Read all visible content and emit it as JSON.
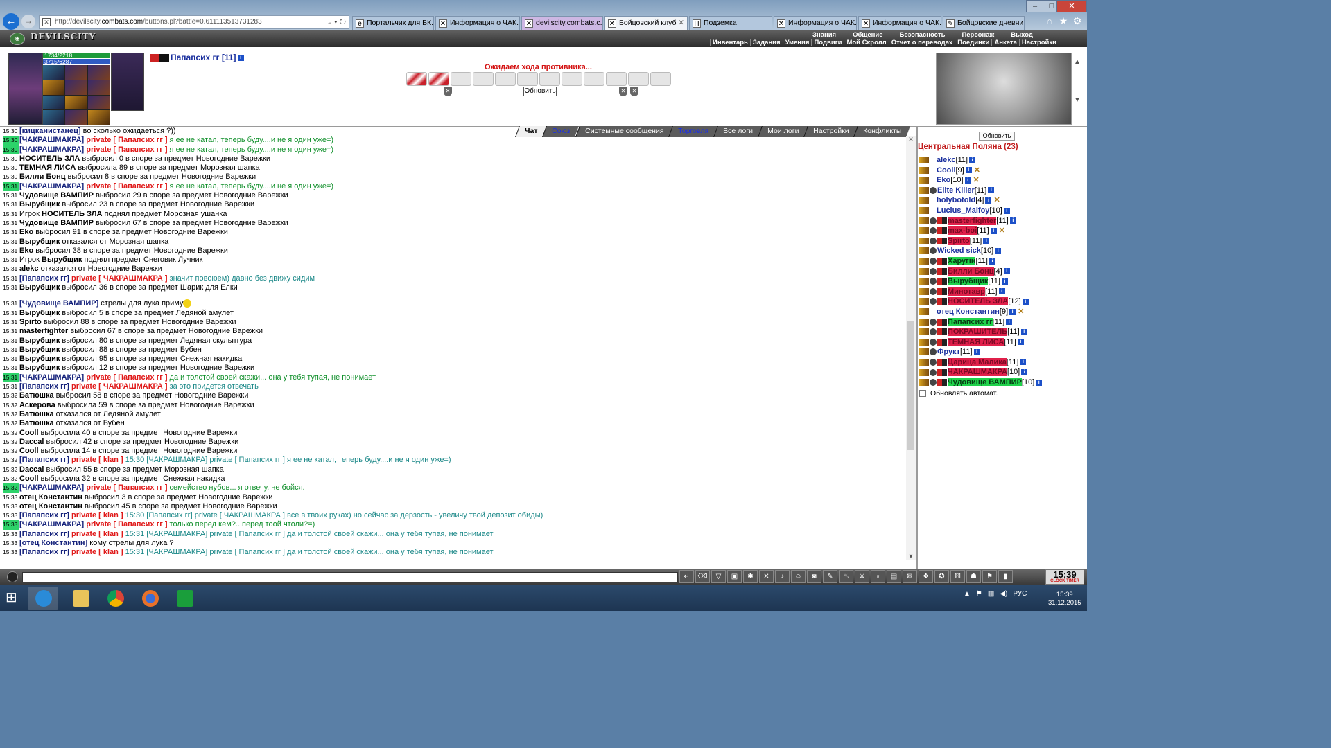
{
  "browser": {
    "address": "http://devilscity.combats.com/buttons.pl?battle=0.611113513731283",
    "address_prefix": "http://devilscity.",
    "address_domain": "combats.com",
    "address_suffix": "/buttons.pl?battle=0.611113513731283",
    "tabs": [
      {
        "label": "Портальчик для БК..."
      },
      {
        "label": "Информация о ЧАК..."
      },
      {
        "label": "devilscity.combats.c..."
      },
      {
        "label": "Бойцовский клуб"
      },
      {
        "label": "Подземка"
      },
      {
        "label": "Информация о ЧАК..."
      },
      {
        "label": "Информация о ЧАК..."
      },
      {
        "label": "Бойцовские дневни..."
      }
    ]
  },
  "game": {
    "logo": "DEVILSCITY",
    "menu_top": [
      "Знания",
      "Общение",
      "Безопасность",
      "Персонаж",
      "Выход"
    ],
    "menu_bottom": [
      "Инвентарь",
      "Задания",
      "Умения",
      "Подвиги",
      "Мой Скролл",
      "Отчет о переводах",
      "Поединки",
      "Анкета",
      "Настройки"
    ]
  },
  "battle": {
    "hp": "1734/2218",
    "mp": "3715/6287",
    "char_name": "Папапсих гг",
    "char_level": "[11]",
    "wait_msg": "Ожидаем хода противника...",
    "refresh": "Обновить"
  },
  "chat_tabs": [
    "Чат",
    "Союз",
    "Системные сообщения",
    "Торговля",
    "Все логи",
    "Мои логи",
    "Настройки",
    "Конфликты"
  ],
  "messages": [
    {
      "time": "15:30",
      "hl": false,
      "parts": [
        [
          "nb",
          "[кицканистанец]"
        ],
        [
          "",
          "",
          " во сколько ожидаеться ?))"
        ]
      ]
    },
    {
      "time": "15:30",
      "hl": false,
      "parts": [
        [
          "nb",
          "[кицканистанец]"
        ],
        [
          "",
          " во сколько ожидаеться ?))"
        ]
      ]
    },
    {
      "time": "15:30",
      "hl": true,
      "parts": [
        [
          "nb",
          "[ЧАКРАШМАКРА]"
        ],
        [
          "pv",
          " private [ Папапсих гг ]"
        ],
        [
          "gt",
          " я ее не катал, теперь буду....и не я один уже=)"
        ]
      ]
    },
    {
      "time": "15:30",
      "hl": true,
      "parts": [
        [
          "nb",
          "[ЧАКРАШМАКРА]"
        ],
        [
          "pv",
          " private [ Папапсих гг ]"
        ],
        [
          "gt",
          " я ее не катал, теперь буду....и не я один уже=)"
        ]
      ]
    },
    {
      "time": "15:30",
      "hl": false,
      "parts": [
        [
          "nk",
          "НОСИТЕЛЬ ЗЛА"
        ],
        [
          "",
          " выбросил 0 в споре за предмет Новогодние Варежки"
        ]
      ]
    },
    {
      "time": "15:30",
      "hl": false,
      "parts": [
        [
          "nk",
          "ТЕМНАЯ ЛИСА"
        ],
        [
          "",
          " выбросила 89 в споре за предмет Морозная шапка"
        ]
      ]
    },
    {
      "time": "15:30",
      "hl": false,
      "parts": [
        [
          "nk",
          "Билли Бонц"
        ],
        [
          "",
          " выбросил 8 в споре за предмет Новогодние Варежки"
        ]
      ]
    },
    {
      "time": "15:31",
      "hl": true,
      "parts": [
        [
          "nb",
          "[ЧАКРАШМАКРА]"
        ],
        [
          "pv",
          " private [ Папапсих гг ]"
        ],
        [
          "gt",
          " я ее не катал, теперь буду....и не я один уже=)"
        ]
      ]
    },
    {
      "time": "15:31",
      "hl": false,
      "parts": [
        [
          "nk",
          "Чудовище ВАМПИР"
        ],
        [
          "",
          " выбросил 29 в споре за предмет Новогодние Варежки"
        ]
      ]
    },
    {
      "time": "15:31",
      "hl": false,
      "parts": [
        [
          "nk",
          "Вырубщик"
        ],
        [
          "",
          " выбросил 23 в споре за предмет Новогодние Варежки"
        ]
      ]
    },
    {
      "time": "15:31",
      "hl": false,
      "parts": [
        [
          "",
          "Игрок "
        ],
        [
          "nk",
          "НОСИТЕЛЬ ЗЛА"
        ],
        [
          "",
          " поднял предмет Морозная ушанка"
        ]
      ]
    },
    {
      "time": "15:31",
      "hl": false,
      "parts": [
        [
          "nk",
          "Чудовище ВАМПИР"
        ],
        [
          "",
          " выбросил 67 в споре за предмет Новогодние Варежки"
        ]
      ]
    },
    {
      "time": "15:31",
      "hl": false,
      "parts": [
        [
          "nk",
          "Eko"
        ],
        [
          "",
          " выбросил 91 в споре за предмет Новогодние Варежки"
        ]
      ]
    },
    {
      "time": "15:31",
      "hl": false,
      "parts": [
        [
          "nk",
          "Вырубщик"
        ],
        [
          "",
          " отказался от Морозная шапка"
        ]
      ]
    },
    {
      "time": "15:31",
      "hl": false,
      "parts": [
        [
          "nk",
          "Eko"
        ],
        [
          "",
          " выбросил 38 в споре за предмет Новогодние Варежки"
        ]
      ]
    },
    {
      "time": "15:31",
      "hl": false,
      "parts": [
        [
          "",
          "Игрок "
        ],
        [
          "nk",
          "Вырубщик"
        ],
        [
          "",
          " поднял предмет Снеговик Лучник"
        ]
      ]
    },
    {
      "time": "15:31",
      "hl": false,
      "parts": [
        [
          "nk",
          "alekc"
        ],
        [
          "",
          " отказался от Новогодние Варежки"
        ]
      ]
    },
    {
      "time": "15:31",
      "hl": false,
      "parts": [
        [
          "nb",
          "[Папапсих гг]"
        ],
        [
          "pv",
          " private [ ЧАКРАШМАКРА ]"
        ],
        [
          "tl",
          " значит повоюем) давно без движу сидим"
        ]
      ]
    },
    {
      "time": "15:31",
      "hl": false,
      "parts": [
        [
          "nk",
          "Вырубщик"
        ],
        [
          "",
          " выбросил 36 в споре за предмет Шарик для Елки"
        ]
      ]
    },
    {
      "time": "15:31",
      "hl": false,
      "smile": true,
      "parts": [
        [
          "nb",
          "[Чудовище ВАМПИР]"
        ],
        [
          "",
          " стрелы для лука приму"
        ]
      ]
    },
    {
      "time": "15:31",
      "hl": false,
      "parts": [
        [
          "nk",
          "Вырубщик"
        ],
        [
          "",
          " выбросил 5 в споре за предмет Ледяной амулет"
        ]
      ]
    },
    {
      "time": "15:31",
      "hl": false,
      "parts": [
        [
          "nk",
          "Spirto"
        ],
        [
          "",
          " выбросил 88 в споре за предмет Новогодние Варежки"
        ]
      ]
    },
    {
      "time": "15:31",
      "hl": false,
      "parts": [
        [
          "nk",
          "masterfighter"
        ],
        [
          "",
          " выбросил 67 в споре за предмет Новогодние Варежки"
        ]
      ]
    },
    {
      "time": "15:31",
      "hl": false,
      "parts": [
        [
          "nk",
          "Вырубщик"
        ],
        [
          "",
          " выбросил 80 в споре за предмет Ледяная скульптура"
        ]
      ]
    },
    {
      "time": "15:31",
      "hl": false,
      "parts": [
        [
          "nk",
          "Вырубщик"
        ],
        [
          "",
          " выбросил 88 в споре за предмет Бубен"
        ]
      ]
    },
    {
      "time": "15:31",
      "hl": false,
      "parts": [
        [
          "nk",
          "Вырубщик"
        ],
        [
          "",
          " выбросил 95 в споре за предмет Снежная накидка"
        ]
      ]
    },
    {
      "time": "15:31",
      "hl": false,
      "parts": [
        [
          "nk",
          "Вырубщик"
        ],
        [
          "",
          " выбросил 12 в споре за предмет Новогодние Варежки"
        ]
      ]
    },
    {
      "time": "15:31",
      "hl": true,
      "parts": [
        [
          "nb",
          "[ЧАКРАШМАКРА]"
        ],
        [
          "pv",
          " private [ Папапсих гг ]"
        ],
        [
          "gt",
          " да и толстой своей скажи... она у тебя тупая, не понимает"
        ]
      ]
    },
    {
      "time": "15:31",
      "hl": false,
      "parts": [
        [
          "nb",
          "[Папапсих гг]"
        ],
        [
          "pv",
          " private [ ЧАКРАШМАКРА ]"
        ],
        [
          "tl",
          " за это придется отвечать"
        ]
      ]
    },
    {
      "time": "15:32",
      "hl": false,
      "parts": [
        [
          "nk",
          "Батюшка"
        ],
        [
          "",
          " выбросил 58 в споре за предмет Новогодние Варежки"
        ]
      ]
    },
    {
      "time": "15:32",
      "hl": false,
      "parts": [
        [
          "nk",
          "Аскерова"
        ],
        [
          "",
          " выбросила 59 в споре за предмет Новогодние Варежки"
        ]
      ]
    },
    {
      "time": "15:32",
      "hl": false,
      "parts": [
        [
          "nk",
          "Батюшка"
        ],
        [
          "",
          " отказался от Ледяной амулет"
        ]
      ]
    },
    {
      "time": "15:32",
      "hl": false,
      "parts": [
        [
          "nk",
          "Батюшка"
        ],
        [
          "",
          " отказался от Бубен"
        ]
      ]
    },
    {
      "time": "15:32",
      "hl": false,
      "parts": [
        [
          "nk",
          "Cooll"
        ],
        [
          "",
          " выбросила 40 в споре за предмет Новогодние Варежки"
        ]
      ]
    },
    {
      "time": "15:32",
      "hl": false,
      "parts": [
        [
          "nk",
          "Daccal"
        ],
        [
          "",
          " выбросил 42 в споре за предмет Новогодние Варежки"
        ]
      ]
    },
    {
      "time": "15:32",
      "hl": false,
      "parts": [
        [
          "nk",
          "Cooll"
        ],
        [
          "",
          " выбросила 14 в споре за предмет Новогодние Варежки"
        ]
      ]
    },
    {
      "time": "15:32",
      "hl": false,
      "parts": [
        [
          "nb",
          "[Папапсих гг]"
        ],
        [
          "pv",
          " private [ klan ]"
        ],
        [
          "tl",
          " 15:30 [ЧАКРАШМАКРА] private [ Папапсих гг ] я ее не катал, теперь буду....и не я один уже=)"
        ]
      ]
    },
    {
      "time": "15:32",
      "hl": false,
      "parts": [
        [
          "nk",
          "Daccal"
        ],
        [
          "",
          " выбросил 55 в споре за предмет Морозная шапка"
        ]
      ]
    },
    {
      "time": "15:32",
      "hl": false,
      "parts": [
        [
          "nk",
          "Cooll"
        ],
        [
          "",
          " выбросила 32 в споре за предмет Снежная накидка"
        ]
      ]
    },
    {
      "time": "15:32",
      "hl": true,
      "parts": [
        [
          "nb",
          "[ЧАКРАШМАКРА]"
        ],
        [
          "pv",
          " private [ Папапсих гг ]"
        ],
        [
          "gt",
          " семейство нубов... я отвечу, не бойся."
        ]
      ]
    },
    {
      "time": "15:33",
      "hl": false,
      "parts": [
        [
          "nk",
          "отец Константин"
        ],
        [
          "",
          " выбросил 3 в споре за предмет Новогодние Варежки"
        ]
      ]
    },
    {
      "time": "15:33",
      "hl": false,
      "parts": [
        [
          "nk",
          "отец Константин"
        ],
        [
          "",
          " выбросил 45 в споре за предмет Новогодние Варежки"
        ]
      ]
    },
    {
      "time": "15:33",
      "hl": false,
      "parts": [
        [
          "nb",
          "[Папапсих гг]"
        ],
        [
          "pv",
          " private [ klan ]"
        ],
        [
          "tl",
          " 15:30 [Папапсих гг] private [ ЧАКРАШМАКРА ] все в твоих руках) но сейчас за дерзость - увеличу твой депозит обиды)"
        ]
      ]
    },
    {
      "time": "15:33",
      "hl": true,
      "parts": [
        [
          "nb",
          "[ЧАКРАШМАКРА]"
        ],
        [
          "pv",
          " private [ Папапсих гг ]"
        ],
        [
          "gt",
          " только перед кем?...перед тоой чтоли?=)"
        ]
      ]
    },
    {
      "time": "15:33",
      "hl": false,
      "parts": [
        [
          "nb",
          "[Папапсих гг]"
        ],
        [
          "pv",
          " private [ klan ]"
        ],
        [
          "tl",
          " 15:31 [ЧАКРАШМАКРА] private [ Папапсих гг ] да и толстой своей скажи... она у тебя тупая, не понимает"
        ]
      ]
    },
    {
      "time": "15:33",
      "hl": false,
      "parts": [
        [
          "nb",
          "[отец Константин]"
        ],
        [
          "",
          " кому стрелы для лука ?"
        ]
      ]
    },
    {
      "time": "15:33",
      "hl": false,
      "parts": [
        [
          "nb",
          "[Папапсих гг]"
        ],
        [
          "pv",
          " private [ klan ]"
        ],
        [
          "tl",
          " 15:31 [ЧАКРАШМАКРА] private [ Папапсих гг ] да и толстой своей скажи... она у тебя тупая, не понимает"
        ]
      ]
    }
  ],
  "panel": {
    "refresh": "Обновить",
    "title": "Центральная Поляна (23)",
    "players": [
      {
        "name": "alekc",
        "lvl": "[11]",
        "style": "",
        "icons": 1,
        "x": false
      },
      {
        "name": "Cooll",
        "lvl": "[9]",
        "style": "",
        "icons": 1,
        "x": true
      },
      {
        "name": "Eko",
        "lvl": "[10]",
        "style": "",
        "icons": 1,
        "x": true
      },
      {
        "name": "Elite Killer",
        "lvl": "[11]",
        "style": "",
        "icons": 2,
        "x": false
      },
      {
        "name": "holybotold",
        "lvl": "[4]",
        "style": "",
        "icons": 1,
        "x": true
      },
      {
        "name": "Lucius_Malfoy",
        "lvl": "[10]",
        "style": "",
        "icons": 1,
        "x": false
      },
      {
        "name": "masterfighter",
        "lvl": "[11]",
        "style": "red",
        "icons": 3,
        "x": false
      },
      {
        "name": "max-boi",
        "lvl": "[11]",
        "style": "red",
        "icons": 3,
        "x": true
      },
      {
        "name": "Spirto",
        "lvl": "[11]",
        "style": "red",
        "icons": 3,
        "x": false
      },
      {
        "name": "Wicked sick",
        "lvl": "[10]",
        "style": "",
        "icons": 2,
        "x": false
      },
      {
        "name": "Харугiн",
        "lvl": "[11]",
        "style": "grn",
        "icons": 3,
        "x": false
      },
      {
        "name": "Билли Бонц",
        "lvl": "[4]",
        "style": "red",
        "icons": 3,
        "x": false
      },
      {
        "name": "Вырубщик",
        "lvl": "[11]",
        "style": "grn",
        "icons": 3,
        "x": false
      },
      {
        "name": "Минотавр",
        "lvl": "[11]",
        "style": "red",
        "icons": 3,
        "x": false
      },
      {
        "name": "НОСИТЕЛЬ ЗЛА",
        "lvl": "[12]",
        "style": "red",
        "icons": 3,
        "x": false
      },
      {
        "name": "отец Константин",
        "lvl": "[9]",
        "style": "",
        "icons": 1,
        "x": true
      },
      {
        "name": "Папапсих гг",
        "lvl": "[11]",
        "style": "grn",
        "icons": 3,
        "x": false
      },
      {
        "name": "ПОКРАШИТЕЛЬ",
        "lvl": "[11]",
        "style": "red",
        "icons": 3,
        "x": false
      },
      {
        "name": "ТЕМНАЯ ЛИСА",
        "lvl": "[11]",
        "style": "red",
        "icons": 3,
        "x": false
      },
      {
        "name": "Фрукт",
        "lvl": "[11]",
        "style": "",
        "icons": 2,
        "x": false
      },
      {
        "name": "Царица Малика",
        "lvl": "[11]",
        "style": "red",
        "icons": 3,
        "x": false
      },
      {
        "name": "ЧАКРАШМАКРА",
        "lvl": "[10]",
        "style": "red",
        "icons": 3,
        "x": false
      },
      {
        "name": "Чудовище ВАМПИР",
        "lvl": "[10]",
        "style": "grn",
        "icons": 3,
        "x": false
      }
    ],
    "auto_update": "Обновлять автомат."
  },
  "clock": {
    "time": "15:39",
    "label": "CLOCK TIMER"
  },
  "taskbar": {
    "lang": "РУС",
    "time": "15:39",
    "date": "31.12.2015"
  }
}
